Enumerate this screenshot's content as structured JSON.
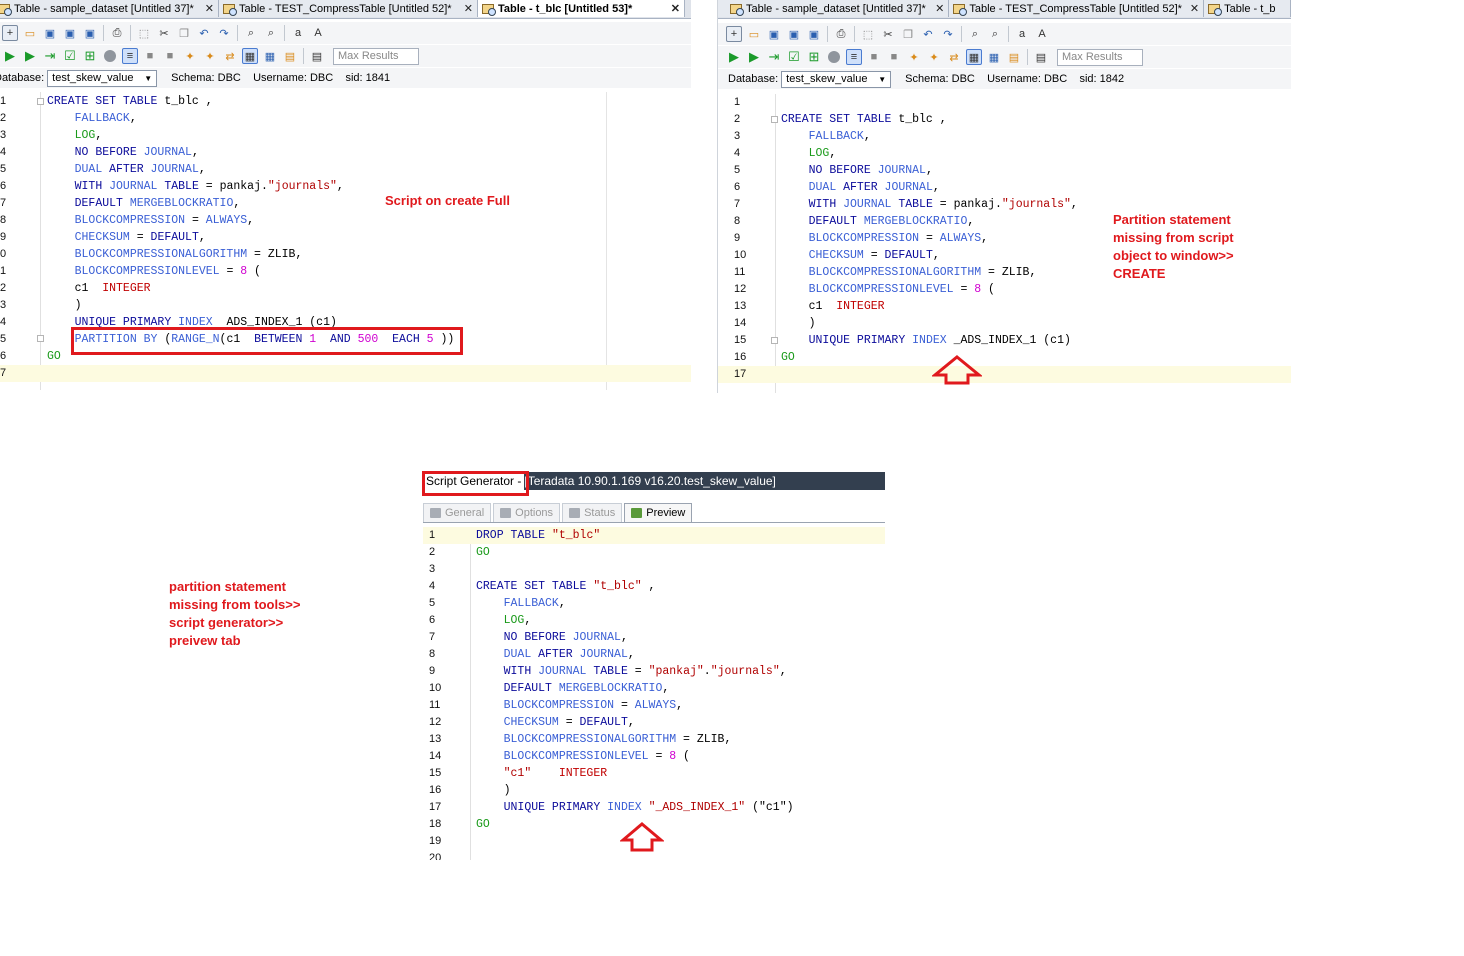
{
  "left": {
    "tabs": [
      {
        "label": "Table - sample_dataset [Untitled 37]*",
        "close": "✕"
      },
      {
        "label": "Table - TEST_CompressTable [Untitled 52]*",
        "close": "✕"
      },
      {
        "label": "Table - t_blc [Untitled 53]*",
        "close": "✕"
      }
    ],
    "max_results_placeholder": "Max Results",
    "database_label": "Database:",
    "database_value": "test_skew_value",
    "schema_label": "Schema:",
    "schema_value": "DBC",
    "username_label": "Username:",
    "username_value": "DBC",
    "sid_label": "sid:",
    "sid_value": "1841",
    "annotation": "Script on create Full",
    "lines": [
      [
        [
          "kw",
          "CREATE SET TABLE "
        ],
        [
          "",
          "t_blc ,"
        ]
      ],
      [
        [
          "",
          "    "
        ],
        [
          "kb",
          "FALLBACK"
        ],
        [
          "",
          ","
        ]
      ],
      [
        [
          "",
          "    "
        ],
        [
          "go",
          "LOG"
        ],
        [
          "",
          ","
        ]
      ],
      [
        [
          "",
          "    "
        ],
        [
          "kw",
          "NO BEFORE "
        ],
        [
          "kb",
          "JOURNAL"
        ],
        [
          "",
          ","
        ]
      ],
      [
        [
          "",
          "    "
        ],
        [
          "kb",
          "DUAL "
        ],
        [
          "kw",
          "AFTER "
        ],
        [
          "kb",
          "JOURNAL"
        ],
        [
          "",
          ","
        ]
      ],
      [
        [
          "",
          "    "
        ],
        [
          "kw",
          "WITH "
        ],
        [
          "kb",
          "JOURNAL "
        ],
        [
          "kw",
          "TABLE "
        ],
        [
          "",
          "= pankaj."
        ],
        [
          "str",
          "\"journals\""
        ],
        [
          "",
          ","
        ]
      ],
      [
        [
          "",
          "    "
        ],
        [
          "kw",
          "DEFAULT "
        ],
        [
          "kb",
          "MERGEBLOCKRATIO"
        ],
        [
          "",
          ","
        ]
      ],
      [
        [
          "",
          "    "
        ],
        [
          "kb",
          "BLOCKCOMPRESSION "
        ],
        [
          "",
          "= "
        ],
        [
          "kb",
          "ALWAYS"
        ],
        [
          "",
          ","
        ]
      ],
      [
        [
          "",
          "    "
        ],
        [
          "kb",
          "CHECKSUM "
        ],
        [
          "",
          "= "
        ],
        [
          "kw",
          "DEFAULT"
        ],
        [
          "",
          ","
        ]
      ],
      [
        [
          "",
          "    "
        ],
        [
          "kb",
          "BLOCKCOMPRESSIONALGORITHM "
        ],
        [
          "",
          "= ZLIB,"
        ]
      ],
      [
        [
          "",
          "    "
        ],
        [
          "kb",
          "BLOCKCOMPRESSIONLEVEL "
        ],
        [
          "",
          "= "
        ],
        [
          "num",
          "8"
        ],
        [
          "",
          "",
          " ("
        ]
      ],
      [
        [
          "",
          "    c1  "
        ],
        [
          "typ",
          "INTEGER"
        ]
      ],
      [
        [
          "",
          "    )"
        ]
      ],
      [
        [
          "",
          "    "
        ],
        [
          "kw",
          "UNIQUE PRIMARY "
        ],
        [
          "kb",
          "INDEX "
        ],
        [
          "",
          "",
          " ADS_INDEX_1 (c1)"
        ]
      ],
      [
        [
          "",
          "    "
        ],
        [
          "kb",
          "PARTITION BY "
        ],
        [
          "",
          "("
        ],
        [
          "kb",
          "RANGE_N"
        ],
        [
          "",
          "(c1  "
        ],
        [
          "kw",
          "BETWEEN "
        ],
        [
          "num",
          "1"
        ],
        [
          "",
          "  "
        ],
        [
          "kw",
          "AND "
        ],
        [
          "num",
          "500"
        ],
        [
          "",
          "  "
        ],
        [
          "kw",
          "EACH "
        ],
        [
          "num",
          "5"
        ],
        [
          "",
          "",
          " ))"
        ]
      ],
      [
        [
          "go",
          "GO"
        ]
      ],
      [
        [
          "",
          ""
        ]
      ]
    ],
    "line_numbers": [
      "1",
      "2",
      "3",
      "4",
      "5",
      "6",
      "7",
      "8",
      "9",
      "0",
      "1",
      "2",
      "3",
      "4",
      "5",
      "6",
      "7"
    ]
  },
  "right": {
    "tabs": [
      {
        "label": "Table - sample_dataset [Untitled 37]*",
        "close": "✕"
      },
      {
        "label": "Table - TEST_CompressTable [Untitled 52]*",
        "close": "✕"
      },
      {
        "label": "Table - t_b",
        "close": ""
      }
    ],
    "max_results_placeholder": "Max Results",
    "database_label": "Database:",
    "database_value": "test_skew_value",
    "schema_label": "Schema:",
    "schema_value": "DBC",
    "username_label": "Username:",
    "username_value": "DBC",
    "sid_label": "sid:",
    "sid_value": "1842",
    "annotation": [
      "Partition statement",
      "missing from script",
      "object to window>>",
      "CREATE"
    ],
    "lines": [
      [
        [
          "",
          ""
        ]
      ],
      [
        [
          "kw",
          "CREATE SET TABLE "
        ],
        [
          "",
          "t_blc ,"
        ]
      ],
      [
        [
          "",
          "    "
        ],
        [
          "kb",
          "FALLBACK"
        ],
        [
          "",
          ","
        ]
      ],
      [
        [
          "",
          "    "
        ],
        [
          "go",
          "LOG"
        ],
        [
          "",
          ","
        ]
      ],
      [
        [
          "",
          "    "
        ],
        [
          "kw",
          "NO BEFORE "
        ],
        [
          "kb",
          "JOURNAL"
        ],
        [
          "",
          ","
        ]
      ],
      [
        [
          "",
          "    "
        ],
        [
          "kb",
          "DUAL "
        ],
        [
          "kw",
          "AFTER "
        ],
        [
          "kb",
          "JOURNAL"
        ],
        [
          "",
          ","
        ]
      ],
      [
        [
          "",
          "    "
        ],
        [
          "kw",
          "WITH "
        ],
        [
          "kb",
          "JOURNAL "
        ],
        [
          "kw",
          "TABLE "
        ],
        [
          "",
          "= pankaj."
        ],
        [
          "str",
          "\"journals\""
        ],
        [
          "",
          ","
        ]
      ],
      [
        [
          "",
          "    "
        ],
        [
          "kw",
          "DEFAULT "
        ],
        [
          "kb",
          "MERGEBLOCKRATIO"
        ],
        [
          "",
          ","
        ]
      ],
      [
        [
          "",
          "    "
        ],
        [
          "kb",
          "BLOCKCOMPRESSION "
        ],
        [
          "",
          "= "
        ],
        [
          "kb",
          "ALWAYS"
        ],
        [
          "",
          ","
        ]
      ],
      [
        [
          "",
          "    "
        ],
        [
          "kb",
          "CHECKSUM "
        ],
        [
          "",
          "= "
        ],
        [
          "kw",
          "DEFAULT"
        ],
        [
          "",
          ","
        ]
      ],
      [
        [
          "",
          "    "
        ],
        [
          "kb",
          "BLOCKCOMPRESSIONALGORITHM "
        ],
        [
          "",
          "= ZLIB,"
        ]
      ],
      [
        [
          "",
          "    "
        ],
        [
          "kb",
          "BLOCKCOMPRESSIONLEVEL "
        ],
        [
          "",
          "= "
        ],
        [
          "num",
          "8"
        ],
        [
          "",
          " ("
        ]
      ],
      [
        [
          "",
          "    c1  "
        ],
        [
          "typ",
          "INTEGER"
        ]
      ],
      [
        [
          "",
          "    )"
        ]
      ],
      [
        [
          "",
          "    "
        ],
        [
          "kw",
          "UNIQUE PRIMARY "
        ],
        [
          "kb",
          "INDEX "
        ],
        [
          "",
          "_ADS_INDEX_1 (c1)"
        ]
      ],
      [
        [
          "go",
          "GO"
        ]
      ],
      [
        [
          "",
          ""
        ]
      ]
    ],
    "line_numbers": [
      "1",
      "2",
      "3",
      "4",
      "5",
      "6",
      "7",
      "8",
      "9",
      "10",
      "11",
      "12",
      "13",
      "14",
      "15",
      "16",
      "17"
    ]
  },
  "generator": {
    "title_label": "Script Generator -",
    "title_rest": " [Teradata 10.90.1.169 v16.20.test_skew_value]",
    "tabs": [
      "General",
      "Options",
      "Status",
      "Preview"
    ],
    "annotation": [
      "partition statement",
      "missing from tools>>",
      "script generator>>",
      "preivew tab"
    ],
    "lines": [
      [
        [
          "kw",
          "DROP "
        ],
        [
          "kw",
          "TABLE "
        ],
        [
          "str",
          "\"t_blc\""
        ]
      ],
      [
        [
          "go",
          "GO"
        ]
      ],
      [
        [
          "",
          ""
        ]
      ],
      [
        [
          "kw",
          "CREATE SET TABLE "
        ],
        [
          "str",
          "\"t_blc\""
        ],
        [
          "",
          " ,"
        ]
      ],
      [
        [
          "",
          "    "
        ],
        [
          "kb",
          "FALLBACK"
        ],
        [
          "",
          ","
        ]
      ],
      [
        [
          "",
          "    "
        ],
        [
          "go",
          "LOG"
        ],
        [
          "",
          ","
        ]
      ],
      [
        [
          "",
          "    "
        ],
        [
          "kw",
          "NO BEFORE "
        ],
        [
          "kb",
          "JOURNAL"
        ],
        [
          "",
          ","
        ]
      ],
      [
        [
          "",
          "    "
        ],
        [
          "kb",
          "DUAL "
        ],
        [
          "kw",
          "AFTER "
        ],
        [
          "kb",
          "JOURNAL"
        ],
        [
          "",
          ","
        ]
      ],
      [
        [
          "",
          "    "
        ],
        [
          "kw",
          "WITH "
        ],
        [
          "kb",
          "JOURNAL "
        ],
        [
          "kw",
          "TABLE "
        ],
        [
          "",
          "= "
        ],
        [
          "str",
          "\"pankaj\""
        ],
        [
          "",
          "."
        ],
        [
          "str",
          "\"journals\""
        ],
        [
          "",
          ","
        ]
      ],
      [
        [
          "",
          "    "
        ],
        [
          "kw",
          "DEFAULT "
        ],
        [
          "kb",
          "MERGEBLOCKRATIO"
        ],
        [
          "",
          ","
        ]
      ],
      [
        [
          "",
          "    "
        ],
        [
          "kb",
          "BLOCKCOMPRESSION "
        ],
        [
          "",
          "= "
        ],
        [
          "kb",
          "ALWAYS"
        ],
        [
          "",
          ","
        ]
      ],
      [
        [
          "",
          "    "
        ],
        [
          "kb",
          "CHECKSUM "
        ],
        [
          "",
          "= "
        ],
        [
          "kw",
          "DEFAULT"
        ],
        [
          "",
          ","
        ]
      ],
      [
        [
          "",
          "    "
        ],
        [
          "kb",
          "BLOCKCOMPRESSIONALGORITHM "
        ],
        [
          "",
          "= ZLIB,"
        ]
      ],
      [
        [
          "",
          "    "
        ],
        [
          "kb",
          "BLOCKCOMPRESSIONLEVEL "
        ],
        [
          "",
          "= "
        ],
        [
          "num",
          "8"
        ],
        [
          "",
          " ("
        ]
      ],
      [
        [
          "",
          "    "
        ],
        [
          "str",
          "\"c1\""
        ],
        [
          "",
          "    "
        ],
        [
          "typ",
          "INTEGER"
        ]
      ],
      [
        [
          "",
          "    )"
        ]
      ],
      [
        [
          "",
          "    "
        ],
        [
          "kw",
          "UNIQUE PRIMARY "
        ],
        [
          "kb",
          "INDEX "
        ],
        [
          "str",
          "\"_ADS_INDEX_1\""
        ],
        [
          "",
          " (\"c1\")"
        ]
      ],
      [
        [
          "go",
          "GO"
        ]
      ],
      [
        [
          "",
          ""
        ]
      ],
      [
        [
          "",
          ""
        ]
      ]
    ],
    "line_numbers": [
      "1",
      "2",
      "3",
      "4",
      "5",
      "6",
      "7",
      "8",
      "9",
      "10",
      "11",
      "12",
      "13",
      "14",
      "15",
      "16",
      "17",
      "18",
      "19",
      "20"
    ]
  }
}
